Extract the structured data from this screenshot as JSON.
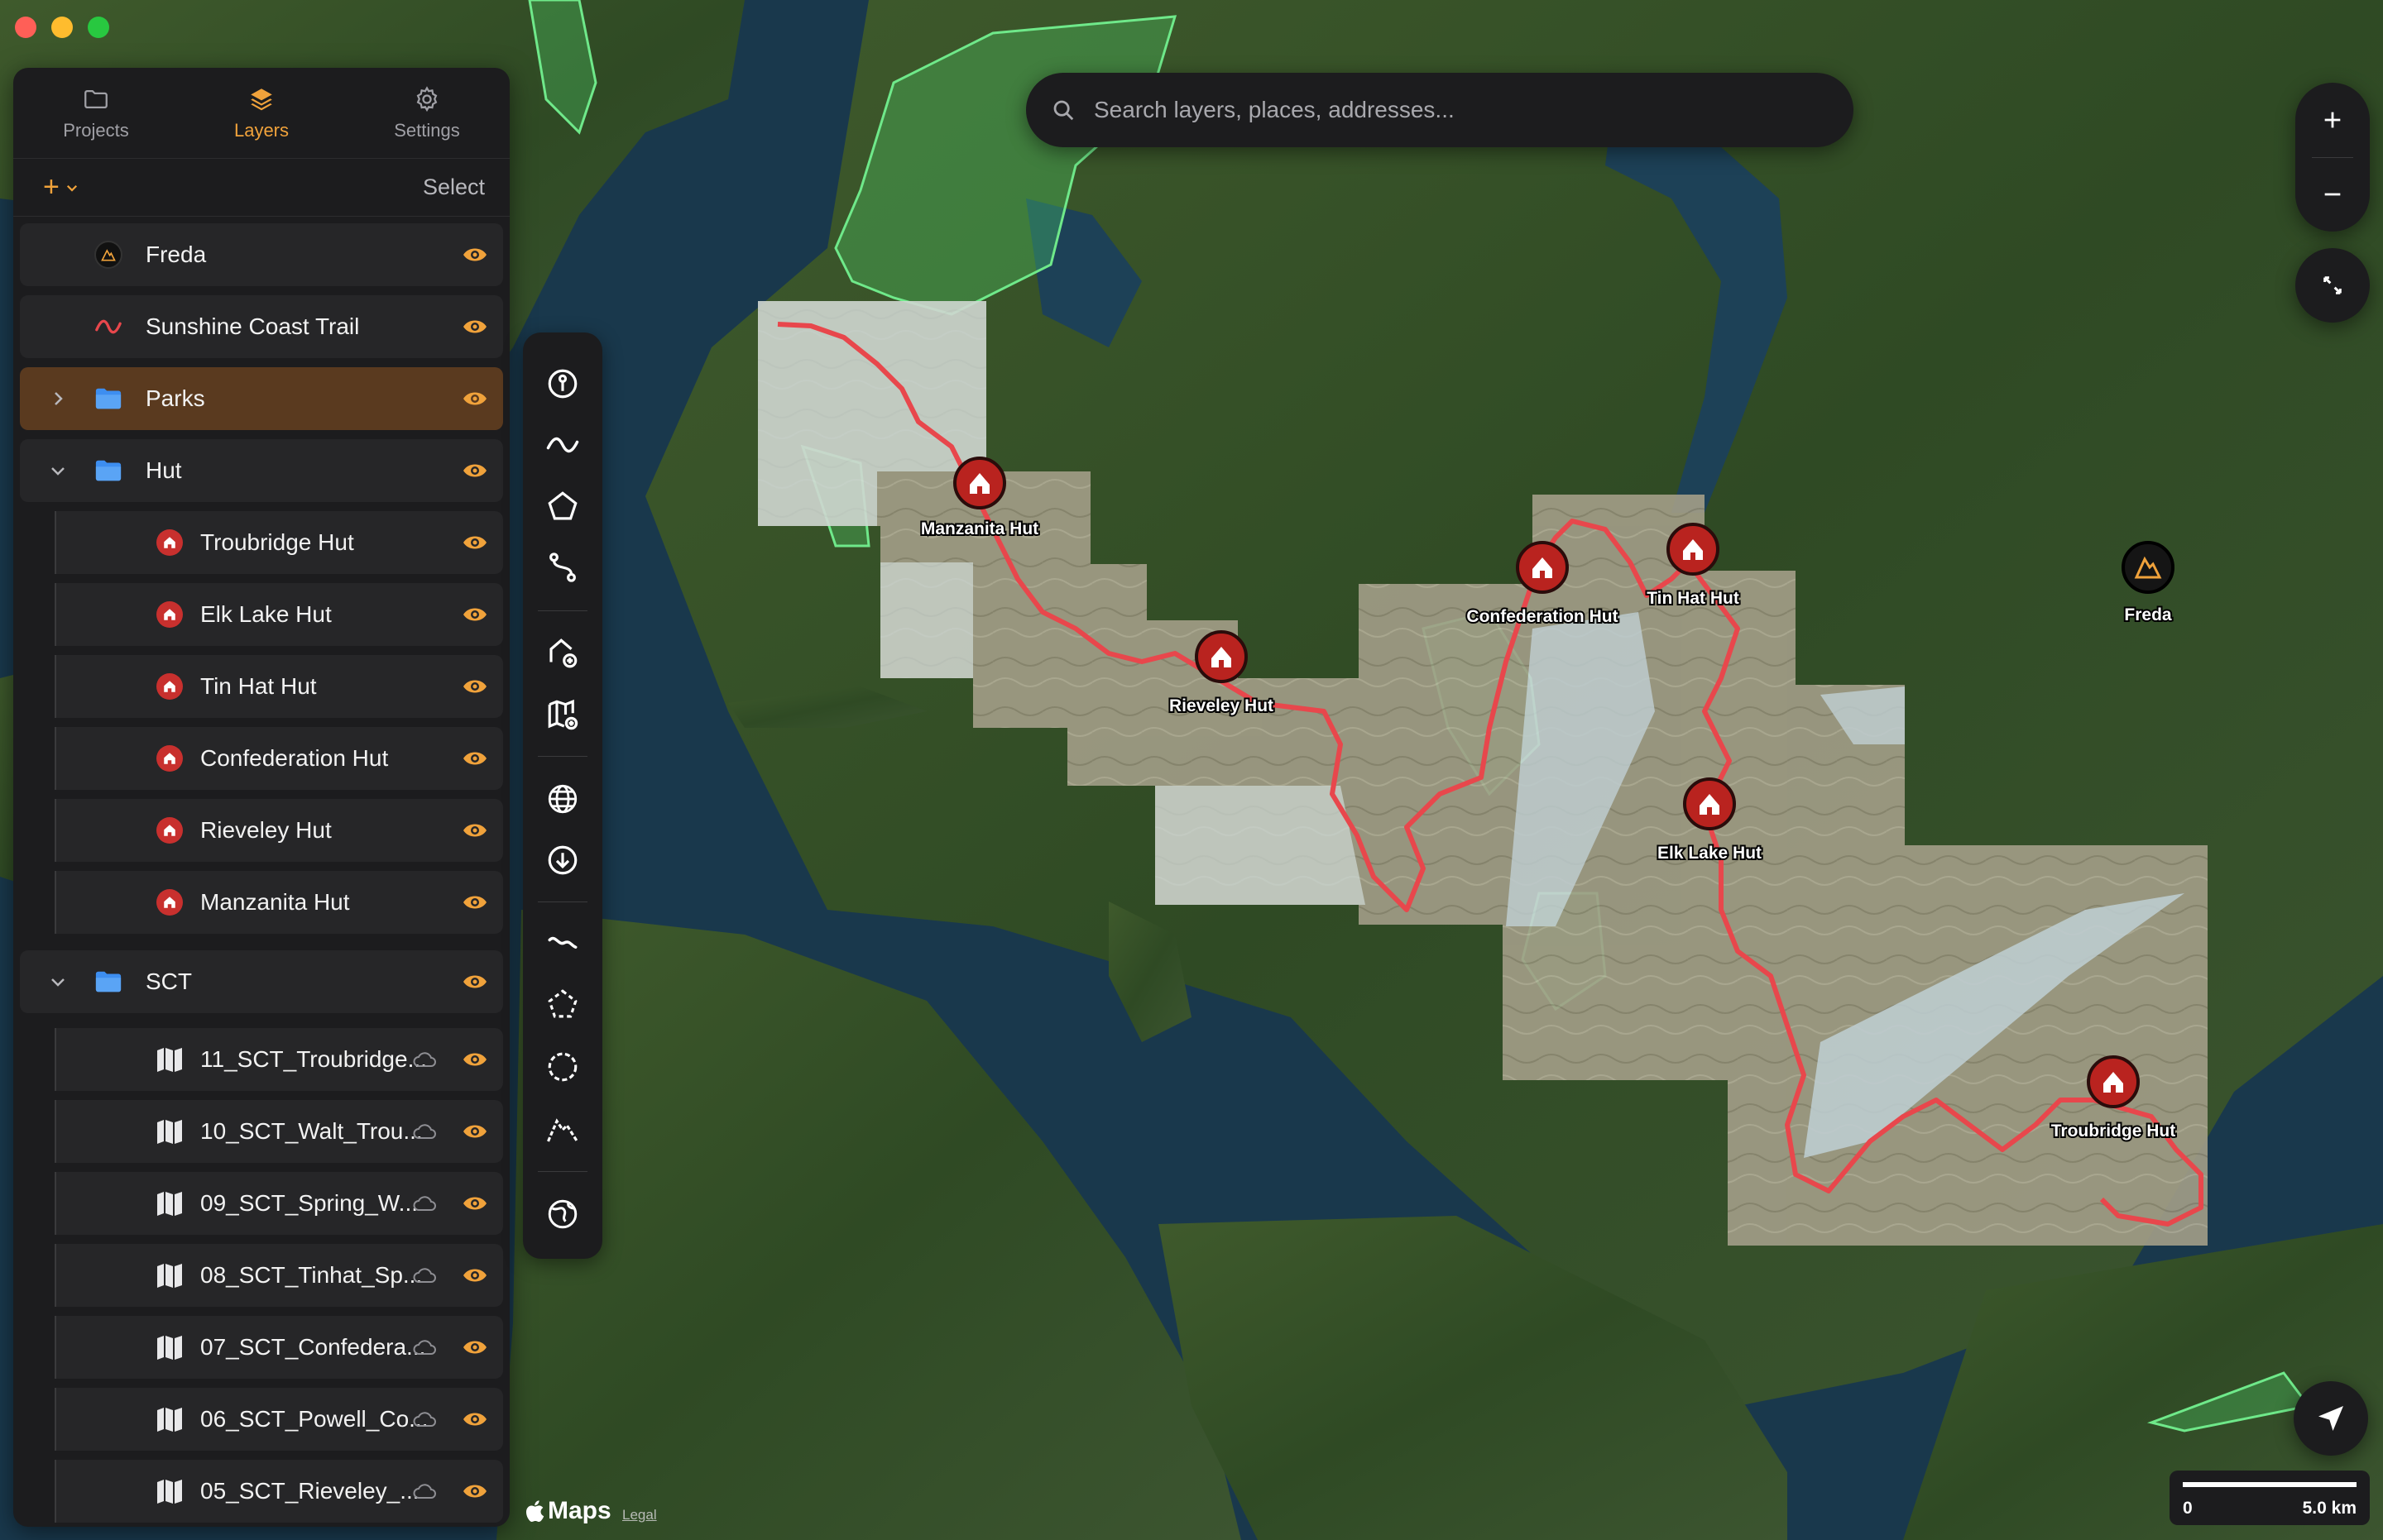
{
  "window": {
    "controls": [
      "close",
      "minimize",
      "zoom"
    ]
  },
  "sidebar": {
    "tabs": [
      {
        "label": "Projects",
        "icon": "folder-icon",
        "active": false
      },
      {
        "label": "Layers",
        "icon": "layers-icon",
        "active": true
      },
      {
        "label": "Settings",
        "icon": "gear-icon",
        "active": false
      }
    ],
    "add_label": "+",
    "select_label": "Select",
    "layers": [
      {
        "label": "Freda",
        "icon": "freda-mountain-icon"
      },
      {
        "label": "Sunshine Coast Trail",
        "icon": "trail-line-icon"
      },
      {
        "label": "Parks",
        "icon": "folder-icon",
        "collapsed": true,
        "selected": true
      },
      {
        "label": "Hut",
        "icon": "folder-icon",
        "expanded": true
      },
      {
        "label": "Troubridge Hut",
        "icon": "hut-icon"
      },
      {
        "label": "Elk Lake Hut",
        "icon": "hut-icon"
      },
      {
        "label": "Tin Hat Hut",
        "icon": "hut-icon"
      },
      {
        "label": "Confederation Hut",
        "icon": "hut-icon"
      },
      {
        "label": "Rieveley Hut",
        "icon": "hut-icon"
      },
      {
        "label": "Manzanita Hut",
        "icon": "hut-icon"
      },
      {
        "label": "SCT",
        "icon": "folder-icon",
        "expanded": true
      },
      {
        "label": "11_SCT_Troubridge...",
        "icon": "map-sheet-icon"
      },
      {
        "label": "10_SCT_Walt_Trou...",
        "icon": "map-sheet-icon"
      },
      {
        "label": "09_SCT_Spring_W...",
        "icon": "map-sheet-icon"
      },
      {
        "label": "08_SCT_Tinhat_Sp...",
        "icon": "map-sheet-icon"
      },
      {
        "label": "07_SCT_Confedera...",
        "icon": "map-sheet-icon"
      },
      {
        "label": "06_SCT_Powell_Co...",
        "icon": "map-sheet-icon"
      },
      {
        "label": "05_SCT_Rieveley_...",
        "icon": "map-sheet-icon"
      }
    ]
  },
  "search": {
    "placeholder": "Search layers, places, addresses..."
  },
  "map": {
    "huts": [
      {
        "label": "Manzanita Hut"
      },
      {
        "label": "Rieveley Hut"
      },
      {
        "label": "Confederation Hut"
      },
      {
        "label": "Tin Hat Hut"
      },
      {
        "label": "Elk Lake Hut"
      },
      {
        "label": "Troubridge Hut"
      }
    ],
    "peak": {
      "label": "Freda"
    },
    "trail_color": "#e8474c",
    "park_color": "#4fd26a",
    "accent_color": "#f0a23b"
  },
  "scale": {
    "start": "0",
    "end": "5.0 km"
  },
  "attribution": {
    "logo": "Maps",
    "legal": "Legal"
  }
}
